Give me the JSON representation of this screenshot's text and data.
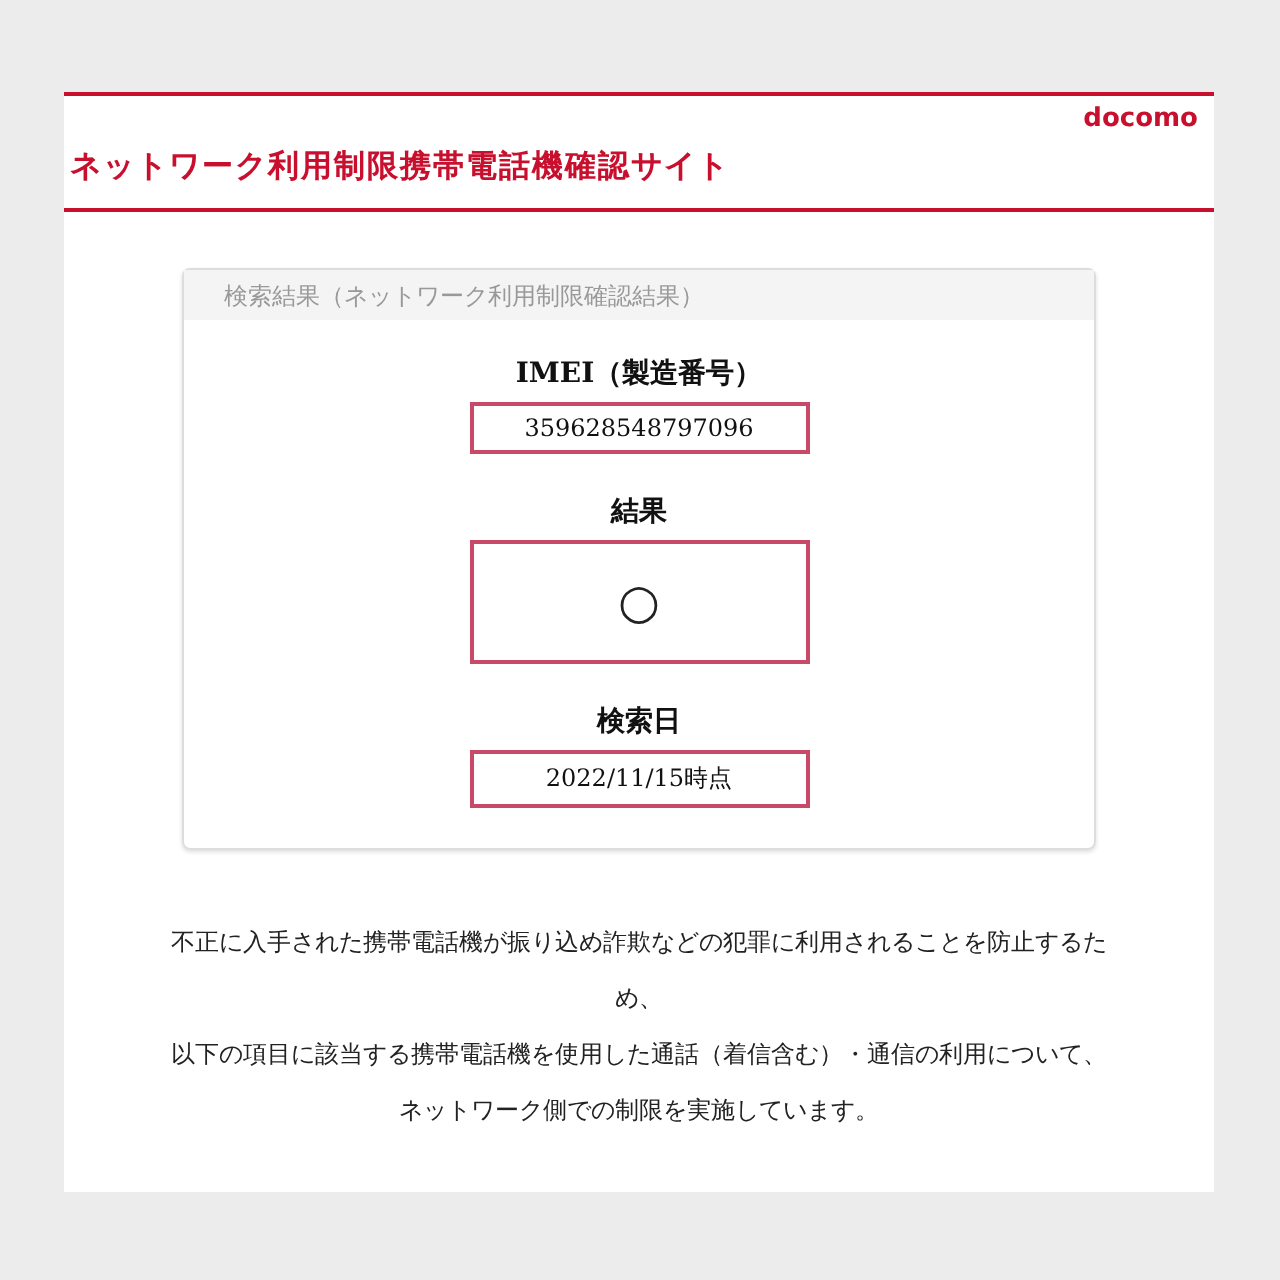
{
  "header": {
    "title": "ネットワーク利用制限携帯電話機確認サイト",
    "logo": "docomo"
  },
  "result_card": {
    "heading": "検索結果（ネットワーク利用制限確認結果）",
    "fields": [
      {
        "label": "IMEI（製造番号）",
        "value": "359628548797096",
        "kind": "text"
      },
      {
        "label": "結果",
        "value": "○",
        "kind": "mark"
      },
      {
        "label": "検索日",
        "value": "2022/11/15時点",
        "kind": "text"
      }
    ]
  },
  "notice": [
    "不正に入手された携帯電話機が振り込め詐欺などの犯罪に利用されることを防止するため、",
    "以下の項目に該当する携帯電話機を使用した通話（着信含む）・通信の利用について、",
    "ネットワーク側での制限を実施しています。"
  ]
}
